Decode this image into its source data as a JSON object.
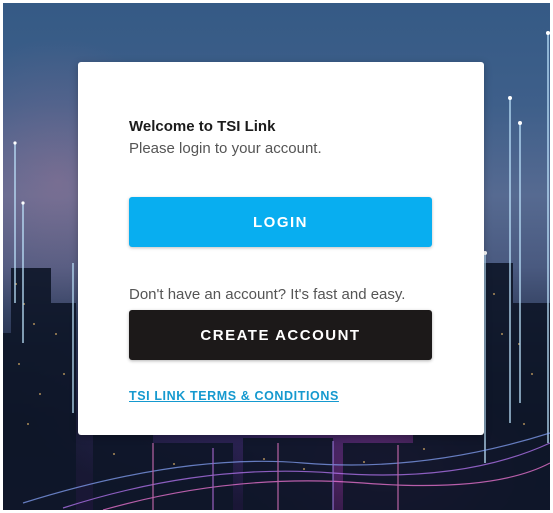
{
  "welcome": {
    "title": "Welcome to TSI Link",
    "subtitle": "Please login to your account."
  },
  "actions": {
    "login_label": "LOGIN",
    "signup_prompt": "Don't have an account? It's fast and easy.",
    "create_account_label": "CREATE ACCOUNT",
    "terms_label": "TSI LINK TERMS & CONDITIONS"
  },
  "colors": {
    "login_button": "#08aef0",
    "create_button": "#1c1919",
    "terms_link": "#1599cf",
    "card_background": "#ffffff"
  },
  "background": {
    "description_icon": "city-skyline-background"
  }
}
